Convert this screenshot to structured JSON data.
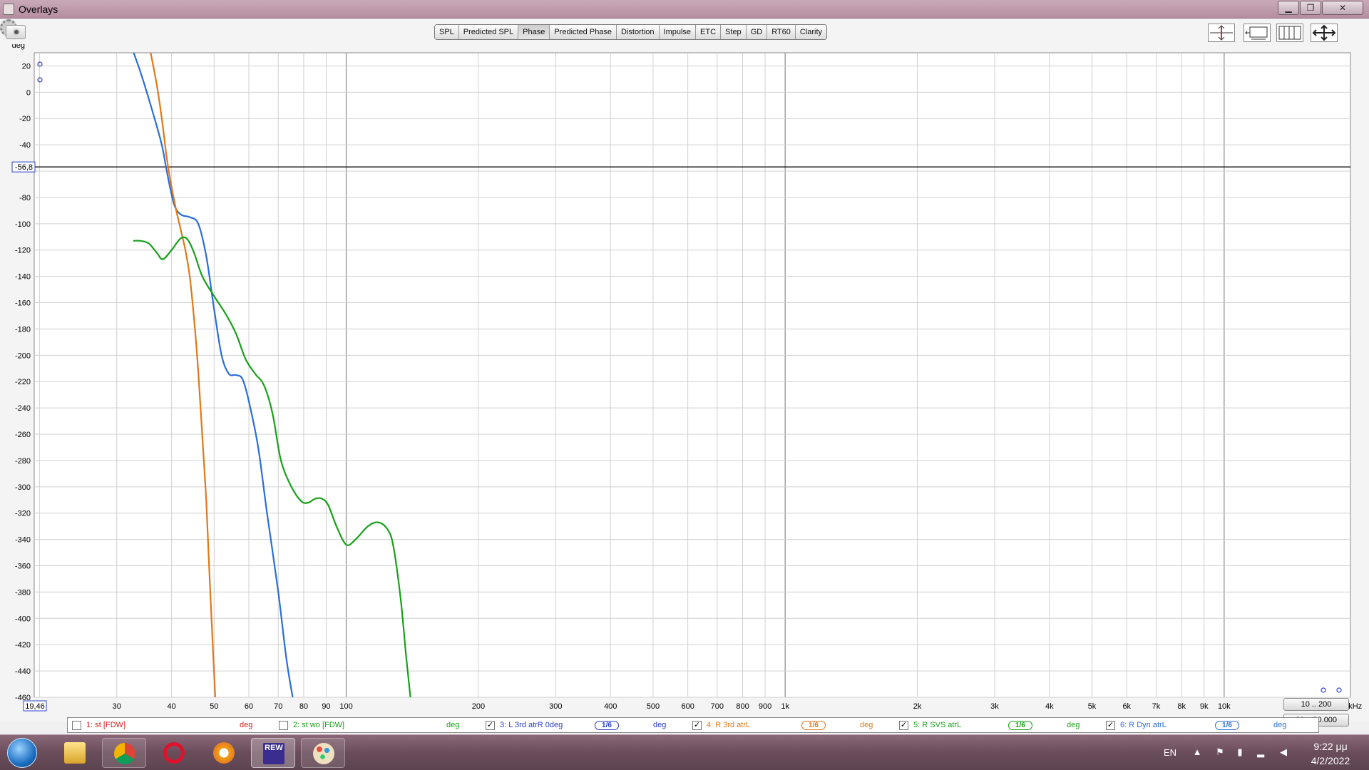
{
  "window": {
    "title": "Overlays"
  },
  "tabs": [
    "SPL",
    "Predicted SPL",
    "Phase",
    "Predicted Phase",
    "Distortion",
    "Impulse",
    "ETC",
    "Step",
    "GD",
    "RT60",
    "Clarity"
  ],
  "active_tab": "Phase",
  "range_buttons": {
    "narrow": "10 .. 200",
    "wide": "20 .. 20.000"
  },
  "legend": [
    {
      "id": "1",
      "label": "1: st [FDW]",
      "checked": false,
      "color": "#d02020",
      "unit": "deg",
      "smoothing": ""
    },
    {
      "id": "2",
      "label": "2: st wo [FDW]",
      "checked": false,
      "color": "#18a018",
      "unit": "deg",
      "smoothing": ""
    },
    {
      "id": "3",
      "label": "3: L 3rd atrR 0deg",
      "checked": true,
      "color": "#2a3fc8",
      "unit": "deg",
      "smoothing": "1/6"
    },
    {
      "id": "4",
      "label": "4: R 3rd atrL",
      "checked": true,
      "color": "#e07818",
      "unit": "deg",
      "smoothing": "1/6"
    },
    {
      "id": "5",
      "label": "5: R SVS atrL",
      "checked": true,
      "color": "#18a018",
      "unit": "deg",
      "smoothing": "1/6"
    },
    {
      "id": "6",
      "label": "6: R Dyn atrL",
      "checked": true,
      "color": "#2a6ed8",
      "unit": "deg",
      "smoothing": "1/6"
    }
  ],
  "taskbar": {
    "rew_label": "REW",
    "language": "EN",
    "time": "9:22 μμ",
    "date": "4/2/2022"
  },
  "chart_data": {
    "type": "line",
    "ylabel": "deg",
    "xlabel": "",
    "x_scale": "log",
    "xlim": [
      19.46,
      19400
    ],
    "ylim": [
      -460,
      30
    ],
    "x_start_label": "19,46",
    "x_end_label": "19,4kHz",
    "cursor_value": -56.8,
    "cursor_label": "-56,8",
    "y_ticks": [
      20,
      0,
      -20,
      -40,
      -80,
      -100,
      -120,
      -140,
      -160,
      -180,
      -200,
      -220,
      -240,
      -260,
      -280,
      -300,
      -320,
      -340,
      -360,
      -380,
      -400,
      -420,
      -440,
      -460
    ],
    "x_ticks": [
      {
        "v": 30,
        "label": "30"
      },
      {
        "v": 40,
        "label": "40"
      },
      {
        "v": 50,
        "label": "50"
      },
      {
        "v": 60,
        "label": "60"
      },
      {
        "v": 70,
        "label": "70"
      },
      {
        "v": 80,
        "label": "80"
      },
      {
        "v": 90,
        "label": "90"
      },
      {
        "v": 100,
        "label": "100"
      },
      {
        "v": 200,
        "label": "200"
      },
      {
        "v": 300,
        "label": "300"
      },
      {
        "v": 400,
        "label": "400"
      },
      {
        "v": 500,
        "label": "500"
      },
      {
        "v": 600,
        "label": "600"
      },
      {
        "v": 700,
        "label": "700"
      },
      {
        "v": 800,
        "label": "800"
      },
      {
        "v": 900,
        "label": "900"
      },
      {
        "v": 1000,
        "label": "1k"
      },
      {
        "v": 2000,
        "label": "2k"
      },
      {
        "v": 3000,
        "label": "3k"
      },
      {
        "v": 4000,
        "label": "4k"
      },
      {
        "v": 5000,
        "label": "5k"
      },
      {
        "v": 6000,
        "label": "6k"
      },
      {
        "v": 7000,
        "label": "7k"
      },
      {
        "v": 8000,
        "label": "8k"
      },
      {
        "v": 9000,
        "label": "9k"
      },
      {
        "v": 10000,
        "label": "10k"
      }
    ],
    "series": [
      {
        "legend_id": "6",
        "color": "#2a6ed8",
        "points": [
          [
            32.7,
            31
          ],
          [
            34,
            15
          ],
          [
            36,
            -12
          ],
          [
            38,
            -40
          ],
          [
            39,
            -60
          ],
          [
            40.5,
            -85
          ],
          [
            42,
            -93
          ],
          [
            44,
            -95
          ],
          [
            46,
            -100
          ],
          [
            48,
            -125
          ],
          [
            50,
            -165
          ],
          [
            52,
            -200
          ],
          [
            54,
            -214
          ],
          [
            56,
            -215
          ],
          [
            58,
            -218
          ],
          [
            60,
            -235
          ],
          [
            63,
            -270
          ],
          [
            66,
            -320
          ],
          [
            70,
            -380
          ],
          [
            73,
            -430
          ],
          [
            75.5,
            -460
          ]
        ]
      },
      {
        "legend_id": "4",
        "color": "#e07818",
        "points": [
          [
            35.8,
            31
          ],
          [
            37,
            6
          ],
          [
            38,
            -20
          ],
          [
            39,
            -50
          ],
          [
            40,
            -72
          ],
          [
            41,
            -90
          ],
          [
            42,
            -105
          ],
          [
            43,
            -120
          ],
          [
            44,
            -140
          ],
          [
            45,
            -172
          ],
          [
            46,
            -212
          ],
          [
            47,
            -262
          ],
          [
            48,
            -312
          ],
          [
            49,
            -380
          ],
          [
            50.3,
            -460
          ]
        ]
      },
      {
        "legend_id": "5",
        "color": "#18a018",
        "points": [
          [
            32.7,
            -113
          ],
          [
            34,
            -113
          ],
          [
            35.5,
            -115
          ],
          [
            37,
            -122
          ],
          [
            38.2,
            -127
          ],
          [
            40,
            -120
          ],
          [
            42,
            -111
          ],
          [
            43.5,
            -112
          ],
          [
            45,
            -122
          ],
          [
            47,
            -140
          ],
          [
            50,
            -155
          ],
          [
            53,
            -168
          ],
          [
            56,
            -183
          ],
          [
            59,
            -203
          ],
          [
            62,
            -214
          ],
          [
            65,
            -223
          ],
          [
            68,
            -245
          ],
          [
            71,
            -280
          ],
          [
            75,
            -300
          ],
          [
            79,
            -311
          ],
          [
            82,
            -312
          ],
          [
            85,
            -309
          ],
          [
            88,
            -309
          ],
          [
            91,
            -314
          ],
          [
            95,
            -330
          ],
          [
            100,
            -344
          ],
          [
            105,
            -340
          ],
          [
            112,
            -330
          ],
          [
            118,
            -327
          ],
          [
            124,
            -332
          ],
          [
            128,
            -345
          ],
          [
            133,
            -385
          ],
          [
            137,
            -430
          ],
          [
            140,
            -460
          ]
        ]
      }
    ]
  }
}
